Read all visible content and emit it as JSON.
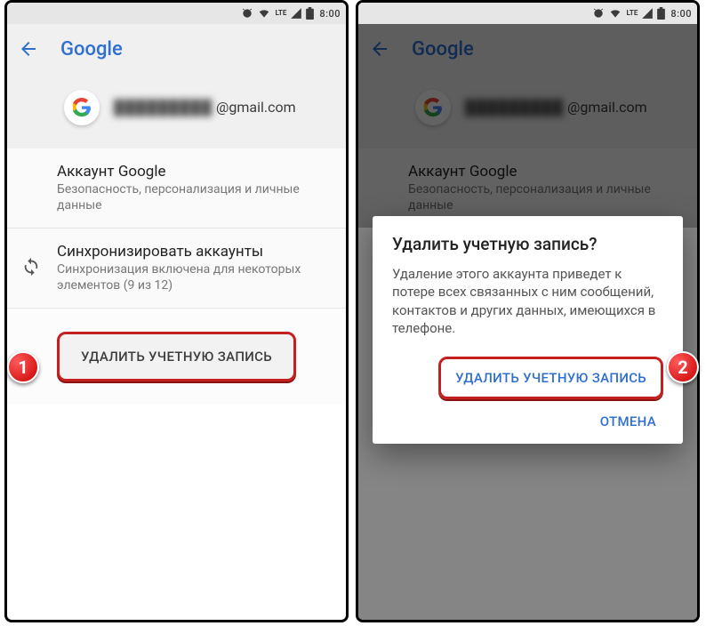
{
  "status": {
    "lte": "LTE",
    "time": "8:00"
  },
  "header": {
    "title": "Google"
  },
  "account": {
    "email_hidden": "█████████",
    "email_domain": "@gmail.com"
  },
  "items": {
    "google_account": {
      "title": "Аккаунт Google",
      "sub": "Безопасность, персонализация и личные данные"
    },
    "sync": {
      "title": "Синхронизировать аккаунты",
      "sub": "Синхронизация включена для некоторых элементов (9 из 12)"
    }
  },
  "remove_button": "УДАЛИТЬ УЧЕТНУЮ ЗАПИСЬ",
  "dialog": {
    "title": "Удалить учетную запись?",
    "body": "Удаление этого аккаунта приведет к потере всех связанных с ним сообщений, контактов и других данных, имеющихся в телефоне.",
    "confirm": "УДАЛИТЬ УЧЕТНУЮ ЗАПИСЬ",
    "cancel": "ОТМЕНА"
  },
  "badges": {
    "one": "1",
    "two": "2"
  }
}
